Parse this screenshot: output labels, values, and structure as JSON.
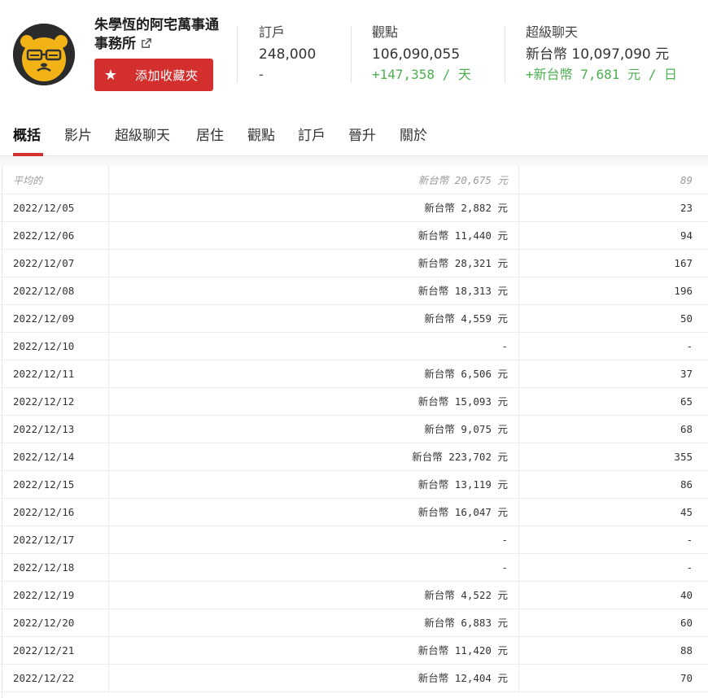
{
  "channel": {
    "name": "朱學恆的阿宅萬事通事務所",
    "favorite_label": "添加收藏夾"
  },
  "stats": {
    "subscribers": {
      "label": "訂戶",
      "value": "248,000",
      "delta": "-"
    },
    "views": {
      "label": "觀點",
      "value": "106,090,055",
      "delta": "+147,358 / 天"
    },
    "superchat": {
      "label": "超級聊天",
      "value": "新台幣 10,097,090 元",
      "delta": "+新台幣 7,681 元 / 日"
    }
  },
  "tabs": [
    {
      "label": "概括",
      "active": true
    },
    {
      "label": "影片"
    },
    {
      "label": "超級聊天"
    },
    {
      "label": "居住"
    },
    {
      "label": "觀點"
    },
    {
      "label": "訂戶"
    },
    {
      "label": "晉升"
    },
    {
      "label": "關於"
    }
  ],
  "table": {
    "average": {
      "date": "平均的",
      "amount": "新台幣 20,675 元",
      "count": "89"
    },
    "rows": [
      {
        "date": "2022/12/05",
        "amount": "新台幣 2,882 元",
        "count": "23"
      },
      {
        "date": "2022/12/06",
        "amount": "新台幣 11,440 元",
        "count": "94"
      },
      {
        "date": "2022/12/07",
        "amount": "新台幣 28,321 元",
        "count": "167"
      },
      {
        "date": "2022/12/08",
        "amount": "新台幣 18,313 元",
        "count": "196"
      },
      {
        "date": "2022/12/09",
        "amount": "新台幣 4,559 元",
        "count": "50"
      },
      {
        "date": "2022/12/10",
        "amount": "-",
        "count": "-"
      },
      {
        "date": "2022/12/11",
        "amount": "新台幣 6,506 元",
        "count": "37"
      },
      {
        "date": "2022/12/12",
        "amount": "新台幣 15,093 元",
        "count": "65"
      },
      {
        "date": "2022/12/13",
        "amount": "新台幣 9,075 元",
        "count": "68"
      },
      {
        "date": "2022/12/14",
        "amount": "新台幣 223,702 元",
        "count": "355"
      },
      {
        "date": "2022/12/15",
        "amount": "新台幣 13,119 元",
        "count": "86"
      },
      {
        "date": "2022/12/16",
        "amount": "新台幣 16,047 元",
        "count": "45"
      },
      {
        "date": "2022/12/17",
        "amount": "-",
        "count": "-"
      },
      {
        "date": "2022/12/18",
        "amount": "-",
        "count": "-"
      },
      {
        "date": "2022/12/19",
        "amount": "新台幣 4,522 元",
        "count": "40"
      },
      {
        "date": "2022/12/20",
        "amount": "新台幣 6,883 元",
        "count": "60"
      },
      {
        "date": "2022/12/21",
        "amount": "新台幣 11,420 元",
        "count": "88"
      },
      {
        "date": "2022/12/22",
        "amount": "新台幣 12,404 元",
        "count": "70"
      }
    ]
  },
  "colors": {
    "accent": "#d32f2f",
    "positive": "#4caf50"
  },
  "icons": {
    "external": "external-link-icon",
    "favorite": "star-icon"
  }
}
